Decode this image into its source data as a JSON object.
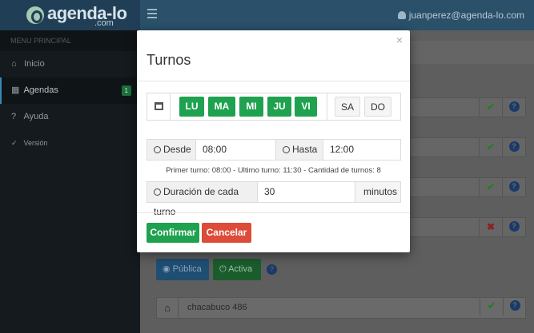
{
  "brand": {
    "name": "agenda-lo",
    "domain": ".com"
  },
  "header": {
    "user_email": "juanperez@agenda-lo.com"
  },
  "sidebar": {
    "heading": "MENU PRINCIPAL",
    "items": [
      {
        "label": "Inicio",
        "icon": "home-icon"
      },
      {
        "label": "Agendas",
        "icon": "calendar-icon",
        "badge": "1"
      },
      {
        "label": "Ayuda",
        "icon": "help-icon"
      },
      {
        "label": "Versión",
        "icon": "check-circle-icon"
      }
    ]
  },
  "background": {
    "buttons": {
      "public": "Pública",
      "active": "Activa"
    },
    "address": "chacabuco 486",
    "status_colors": {
      "ok": "#2a7a2a",
      "error": "#8c2020"
    }
  },
  "modal": {
    "close": "×",
    "title": "Turnos",
    "days_on": [
      "LU",
      "MA",
      "MI",
      "JU",
      "VI"
    ],
    "days_off": [
      "SA",
      "DO"
    ],
    "desde_label": "Desde",
    "desde_value": "08:00",
    "hasta_label": "Hasta",
    "hasta_value": "12:00",
    "summary": "Primer turno: 08:00 - Ultimo turno: 11:30 - Cantidad de turnos: 8",
    "duration_label": "Duración de cada turno",
    "duration_value": "30",
    "duration_unit": "minutos",
    "confirm": "Confirmar",
    "cancel": "Cancelar"
  },
  "colors": {
    "accent_green": "#1fa24f",
    "danger": "#dd4b39",
    "header": "#2a506a"
  }
}
